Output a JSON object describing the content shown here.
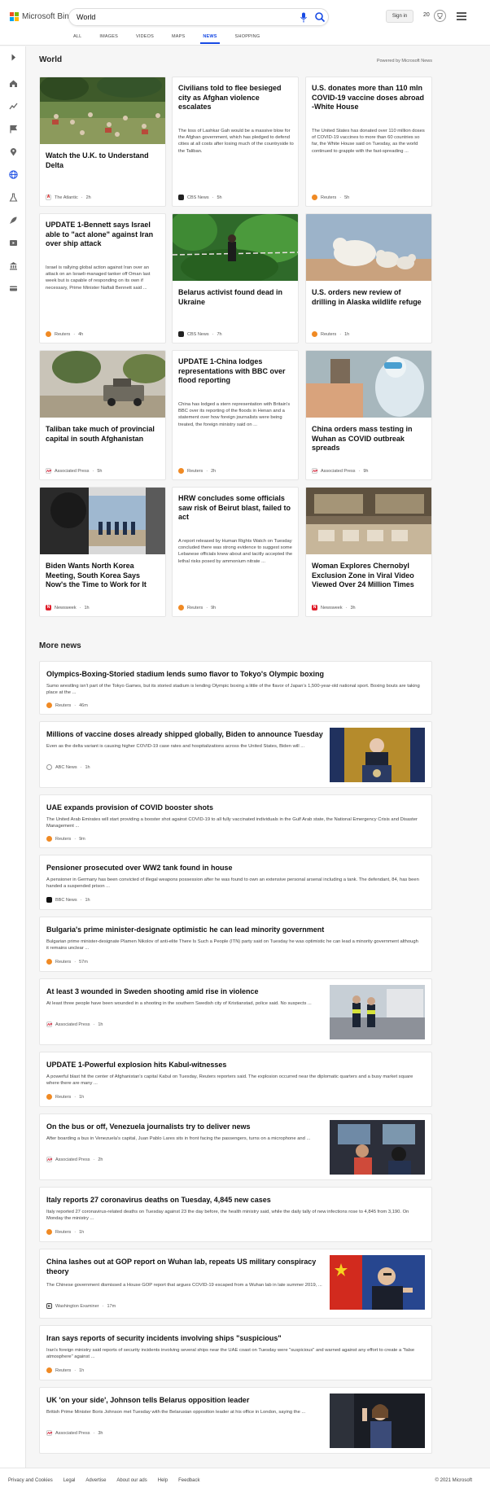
{
  "app": {
    "brand": "Microsoft Bing"
  },
  "search": {
    "value": "World"
  },
  "header": {
    "sign_in": "Sign in",
    "points": "20"
  },
  "nav": {
    "tabs": [
      {
        "label": "ALL",
        "active": false
      },
      {
        "label": "IMAGES",
        "active": false
      },
      {
        "label": "VIDEOS",
        "active": false
      },
      {
        "label": "MAPS",
        "active": false
      },
      {
        "label": "NEWS",
        "active": true
      },
      {
        "label": "SHOPPING",
        "active": false
      }
    ]
  },
  "section": {
    "title": "World",
    "powered": "Powered by Microsoft News"
  },
  "cards": [
    {
      "title": "Watch the U.K. to Understand Delta",
      "snippet": "",
      "source": "The Atlantic",
      "time": "2h"
    },
    {
      "title": "Civilians told to flee besieged city as Afghan violence escalates",
      "snippet": "The loss of Lashkar Gah would be a massive blow for the Afghan government, which has pledged to defend cities at all costs after losing much of the countryside to the Taliban.",
      "source": "CBS News",
      "time": "5h"
    },
    {
      "title": "U.S. donates more than 110 mln COVID-19 vaccine doses abroad -White House",
      "snippet": "The United States has donated over 110 million doses of COVID-19 vaccines to more than 60 countries so far, the White House said on Tuesday, as the world continued to grapple with the fast-spreading ...",
      "source": "Reuters",
      "time": "5h"
    },
    {
      "title": "UPDATE 1-Bennett says Israel able to \"act alone\" against Iran over ship attack",
      "snippet": "Israel is rallying global action against Iran over an attack on an Israeli-managed tanker off Oman last week but is capable of responding on its own if necessary, Prime Minister Naftali Bennett said ...",
      "source": "Reuters",
      "time": "4h"
    },
    {
      "title": "Belarus activist found dead in Ukraine",
      "snippet": "",
      "source": "CBS News",
      "time": "7h"
    },
    {
      "title": "U.S. orders new review of drilling in Alaska wildlife refuge",
      "snippet": "",
      "source": "Reuters",
      "time": "1h"
    },
    {
      "title": "Taliban take much of provincial capital in south Afghanistan",
      "snippet": "",
      "source": "Associated Press",
      "time": "5h"
    },
    {
      "title": "UPDATE 1-China lodges representations with BBC over flood reporting",
      "snippet": "China has lodged a stern representation with Britain's BBC over its reporting of the floods in Henan and a statement over how foreign journalists were being treated, the foreign ministry said on ...",
      "source": "Reuters",
      "time": "2h"
    },
    {
      "title": "China orders mass testing in Wuhan as COVID outbreak spreads",
      "snippet": "",
      "source": "Associated Press",
      "time": "9h"
    },
    {
      "title": "Biden Wants North Korea Meeting, South Korea Says Now's the Time to Work for It",
      "snippet": "",
      "source": "Newsweek",
      "time": "1h"
    },
    {
      "title": "HRW concludes some officials saw risk of Beirut blast, failed to act",
      "snippet": "A report released by Human Rights Watch on Tuesday concluded there was strong evidence to suggest some Lebanese officials knew about and tacitly accepted the lethal risks posed by ammonium nitrate ...",
      "source": "Reuters",
      "time": "9h"
    },
    {
      "title": "Woman Explores Chernobyl Exclusion Zone in Viral Video Viewed Over 24 Million Times",
      "snippet": "",
      "source": "Newsweek",
      "time": "3h"
    }
  ],
  "more": {
    "title": "More news",
    "items": [
      {
        "title": "Olympics-Boxing-Storied stadium lends sumo flavor to Tokyo's Olympic boxing",
        "snippet": "Sumo wrestling isn't part of the Tokyo Games, but its storied stadium is lending Olympic boxing a little of the flavor of Japan's 1,500-year-old national sport. Boxing bouts are taking place at the ...",
        "source": "Reuters",
        "time": "46m"
      },
      {
        "title": "Millions of vaccine doses already shipped globally, Biden to announce Tuesday",
        "snippet": "Even as the delta variant is causing higher COVID-19 case rates and hospitalizations across the United States, Biden will ...",
        "source": "ABC News",
        "time": "1h"
      },
      {
        "title": "UAE expands provision of COVID booster shots",
        "snippet": "The United Arab Emirates will start providing a booster shot against COVID-19 to all fully vaccinated individuals in the Gulf Arab state, the National Emergency Crisis and Disaster Management ...",
        "source": "Reuters",
        "time": "9m"
      },
      {
        "title": "Pensioner prosecuted over WW2 tank found in house",
        "snippet": "A pensioner in Germany has been convicted of illegal weapons possession after he was found to own an extensive personal arsenal including a tank. The defendant, 84, has been handed a suspended prison ...",
        "source": "BBC News",
        "time": "1h"
      },
      {
        "title": "Bulgaria's prime minister-designate optimistic he can lead minority government",
        "snippet": "Bulgarian prime minister-designate Plamen Nikolov of anti-elite There Is Such a People (ITN) party said on Tuesday he was optimistic he can lead a minority government although it remains unclear ...",
        "source": "Reuters",
        "time": "57m"
      },
      {
        "title": "At least 3 wounded in Sweden shooting amid rise in violence",
        "snippet": "At least three people have been wounded in a shooting in the southern Swedish city of Kristianstad, police said. No suspects ...",
        "source": "Associated Press",
        "time": "1h"
      },
      {
        "title": "UPDATE 1-Powerful explosion hits Kabul-witnesses",
        "snippet": "A powerful blast hit the center of Afghanistan's capital Kabul on Tuesday, Reuters reporters said. The explosion occurred near the diplomatic quarters and a busy market square where there are many ...",
        "source": "Reuters",
        "time": "1h"
      },
      {
        "title": "On the bus or off, Venezuela journalists try to deliver news",
        "snippet": "After boarding a bus in Venezuela's capital, Juan Pablo Lares sits in front facing the passengers, turns on a microphone and ...",
        "source": "Associated Press",
        "time": "2h"
      },
      {
        "title": "Italy reports 27 coronavirus deaths on Tuesday, 4,845 new cases",
        "snippet": "Italy reported 27 coronavirus-related deaths on Tuesday against 23 the day before, the health ministry said, while the daily tally of new infections rose to 4,845 from 3,190. On Monday the ministry ...",
        "source": "Reuters",
        "time": "1h"
      },
      {
        "title": "China lashes out at GOP report on Wuhan lab, repeats US military conspiracy theory",
        "snippet": "The Chinese government dismissed a House GOP report that argues COVID-19 escaped from a Wuhan lab in late summer 2019, ...",
        "source": "Washington Examiner",
        "time": "17m"
      },
      {
        "title": "Iran says reports of security incidents involving ships \"suspicious\"",
        "snippet": "Iran's foreign ministry said reports of security incidents involving several ships near the UAE coast on Tuesday were \"suspicious\" and warned against any effort to create a \"false atmosphere\" against ...",
        "source": "Reuters",
        "time": "1h"
      },
      {
        "title": "UK 'on your side', Johnson tells Belarus opposition leader",
        "snippet": "British Prime Minister Boris Johnson met Tuesday with the Belarusian opposition leader at his office in London, saying the ...",
        "source": "Associated Press",
        "time": "3h"
      }
    ]
  },
  "footer": {
    "links": [
      "Privacy and Cookies",
      "Legal",
      "Advertise",
      "About our ads",
      "Help",
      "Feedback"
    ],
    "copyright": "© 2021 Microsoft"
  },
  "colors": {
    "accent": "#174ae4",
    "reuters": "#f08a24",
    "ap": "#d0021b",
    "newsweek": "#e01e2b"
  }
}
